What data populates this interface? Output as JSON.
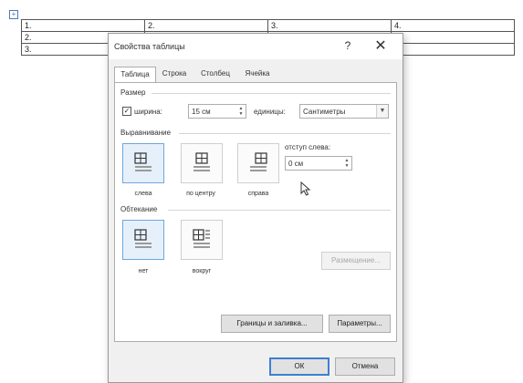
{
  "document": {
    "table": {
      "rows": [
        [
          "1.",
          "2.",
          "3.",
          "4."
        ],
        [
          "2.",
          "",
          "",
          ""
        ],
        [
          "3.",
          "",
          "",
          ""
        ]
      ]
    }
  },
  "dialog": {
    "title": "Свойства таблицы",
    "help_label": "?",
    "close_label": "✕",
    "tabs": [
      {
        "label": "Таблица",
        "active": true
      },
      {
        "label": "Строка",
        "active": false
      },
      {
        "label": "Столбец",
        "active": false
      },
      {
        "label": "Ячейка",
        "active": false
      }
    ],
    "size": {
      "group_label": "Размер",
      "width_checked": true,
      "width_label": "ширина:",
      "width_value": "15 см",
      "units_label": "единицы:",
      "units_value": "Сантиметры"
    },
    "alignment": {
      "group_label": "Выравнивание",
      "options": [
        {
          "label": "слева",
          "selected": true
        },
        {
          "label": "по центру",
          "selected": false
        },
        {
          "label": "справа",
          "selected": false
        }
      ],
      "indent_label": "отступ слева:",
      "indent_value": "0 см"
    },
    "wrapping": {
      "group_label": "Обтекание",
      "options": [
        {
          "label": "нет",
          "selected": true
        },
        {
          "label": "вокруг",
          "selected": false
        }
      ],
      "positioning_button": "Размещение..."
    },
    "borders_button": "Границы и заливка...",
    "options_button": "Параметры...",
    "ok_button": "ОК",
    "cancel_button": "Отмена"
  }
}
